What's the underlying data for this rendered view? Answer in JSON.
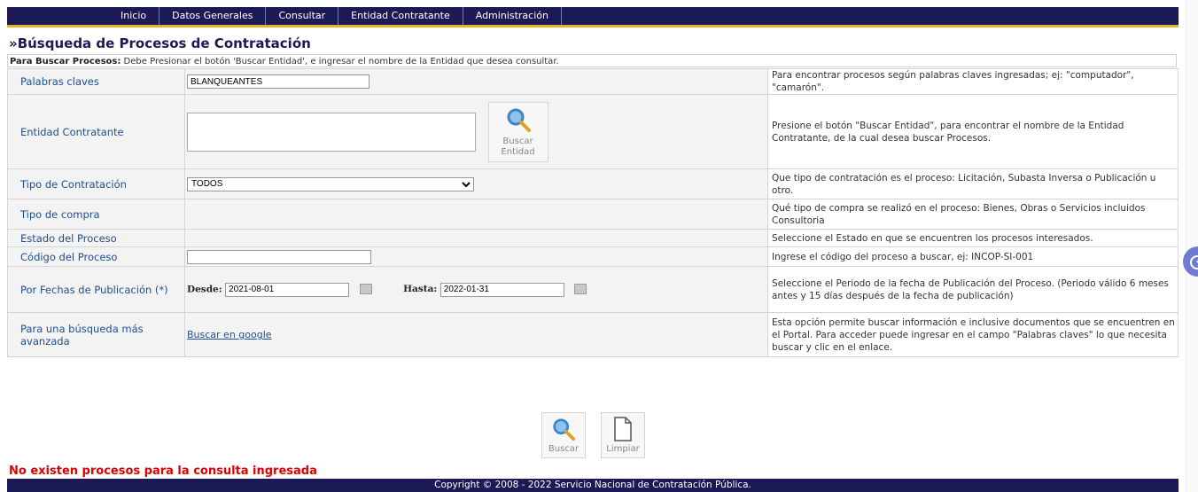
{
  "nav": {
    "items": [
      "Inicio",
      "Datos Generales",
      "Consultar",
      "Entidad Contratante",
      "Administración"
    ]
  },
  "page": {
    "title": "»Búsqueda de Procesos de Contratación",
    "instruction_bold": "Para Buscar Procesos:",
    "instruction_text": " Debe Presionar el botón 'Buscar Entidad', e ingresar el nombre de la Entidad que desea consultar."
  },
  "form": {
    "rows": [
      {
        "label": "Palabras claves",
        "help": "Para encontrar procesos según palabras claves ingresadas; ej: \"computador\", \"camarón\"."
      },
      {
        "label": "Entidad Contratante",
        "help": "Presione el botón \"Buscar Entidad\", para encontrar el nombre de la Entidad Contratante, de la cual desea buscar Procesos."
      },
      {
        "label": "Tipo de Contratación",
        "help": "Que tipo de contratación es el proceso: Licitación, Subasta Inversa o Publicación u otro."
      },
      {
        "label": "Tipo de compra",
        "help": "Qué tipo de compra se realizó en el proceso: Bienes, Obras o Servicios incluidos Consultoria"
      },
      {
        "label": "Estado del Proceso",
        "help": "Seleccione el Estado en que se encuentren los procesos interesados."
      },
      {
        "label": "Código del Proceso",
        "help": "Ingrese el código del proceso a buscar, ej: INCOP-SI-001"
      },
      {
        "label": "Por Fechas de Publicación (*)",
        "help": "Seleccione el Periodo de la fecha de Publicación del Proceso. (Periodo válido 6 meses antes y 15 días después de la fecha de publicación)"
      },
      {
        "label": "Para una búsqueda más avanzada",
        "help": "Esta opción permite buscar información e inclusive documentos que se encuentren en el Portal. Para acceder puede ingresar en el campo \"Palabras claves\" lo que necesita buscar y clic en el enlace."
      }
    ],
    "keywords_value": "BLANQUEANTES",
    "entity_value": "",
    "buscar_entidad_line1": "Buscar",
    "buscar_entidad_line2": "Entidad",
    "tipo_contratacion_selected": "TODOS",
    "codigo_value": "",
    "desde_label": "Desde:",
    "desde_value": "2021-08-01",
    "hasta_label": "Hasta:",
    "hasta_value": "2022-01-31",
    "google_link": "Buscar en google"
  },
  "buttons": {
    "buscar": "Buscar",
    "limpiar": "Limpiar"
  },
  "status": {
    "no_results": "No existen procesos para la consulta ingresada"
  },
  "footer": {
    "text": "Copyright © 2008 - 2022 Servicio Nacional de Contratación Pública."
  },
  "colors": {
    "nav_bg": "#1c1a56",
    "nav_accent": "#e3b521",
    "label_blue": "#1f4f8a",
    "error_red": "#e00000"
  }
}
